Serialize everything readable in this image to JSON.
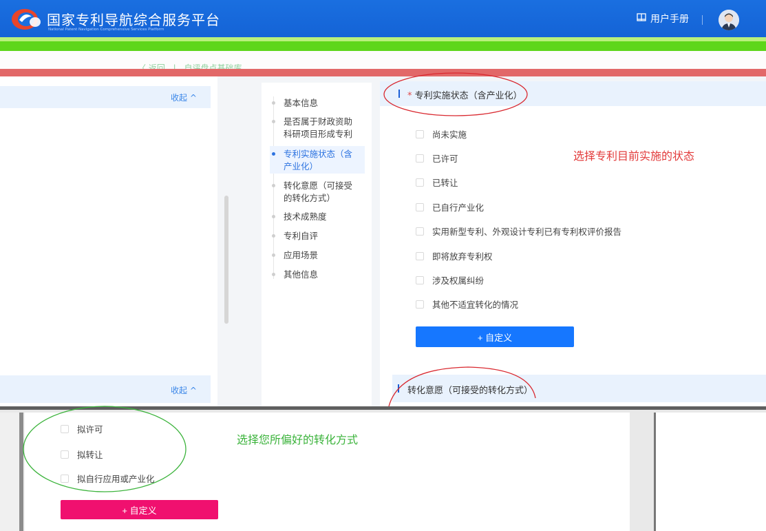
{
  "header": {
    "title": "国家专利导航综合服务平台",
    "subtitle": "National Patent Navigation Comprehensive Services Platform",
    "manual_label": "用户手册",
    "manual_icon": "book-icon",
    "avatar_icon": "user-avatar-icon"
  },
  "breadcrumb": {
    "back": "〈 返回",
    "separator": "|",
    "current": "自评盘点基础库"
  },
  "left_panel": {
    "collapse_label": "收起 ^",
    "collapse_label_2": "收起 ^"
  },
  "nav": {
    "items": [
      {
        "label": "基本信息"
      },
      {
        "label": "是否属于财政资助科研项目形成专利"
      },
      {
        "label": "专利实施状态（含产业化）"
      },
      {
        "label": "转化意愿（可接受的转化方式）"
      },
      {
        "label": "技术成熟度"
      },
      {
        "label": "专利自评"
      },
      {
        "label": "应用场景"
      },
      {
        "label": "其他信息"
      }
    ],
    "active_index": 2
  },
  "section1": {
    "required_mark": "*",
    "title": "专利实施状态（含产业化）",
    "options": [
      "尚未实施",
      "已许可",
      "已转让",
      "已自行产业化",
      "实用新型专利、外观设计专利已有专利权评价报告",
      "即将放弃专利权",
      "涉及权属纠纷",
      "其他不适宜转化的情况"
    ],
    "custom_button": "+ 自定义",
    "annotation": "选择专利目前实施的状态"
  },
  "section2": {
    "title": "转化意愿（可接受的转化方式）",
    "options": [
      "拟许可",
      "拟转让",
      "拟自行应用或产业化"
    ],
    "custom_button": "+ 自定义",
    "annotation": "选择您所偏好的转化方式"
  },
  "colors": {
    "primary": "#1677ff",
    "pink_button": "#f0106f",
    "annotation_red": "#e23b3b",
    "annotation_green": "#3bb33b",
    "header_blue": "#1a6fe0"
  }
}
